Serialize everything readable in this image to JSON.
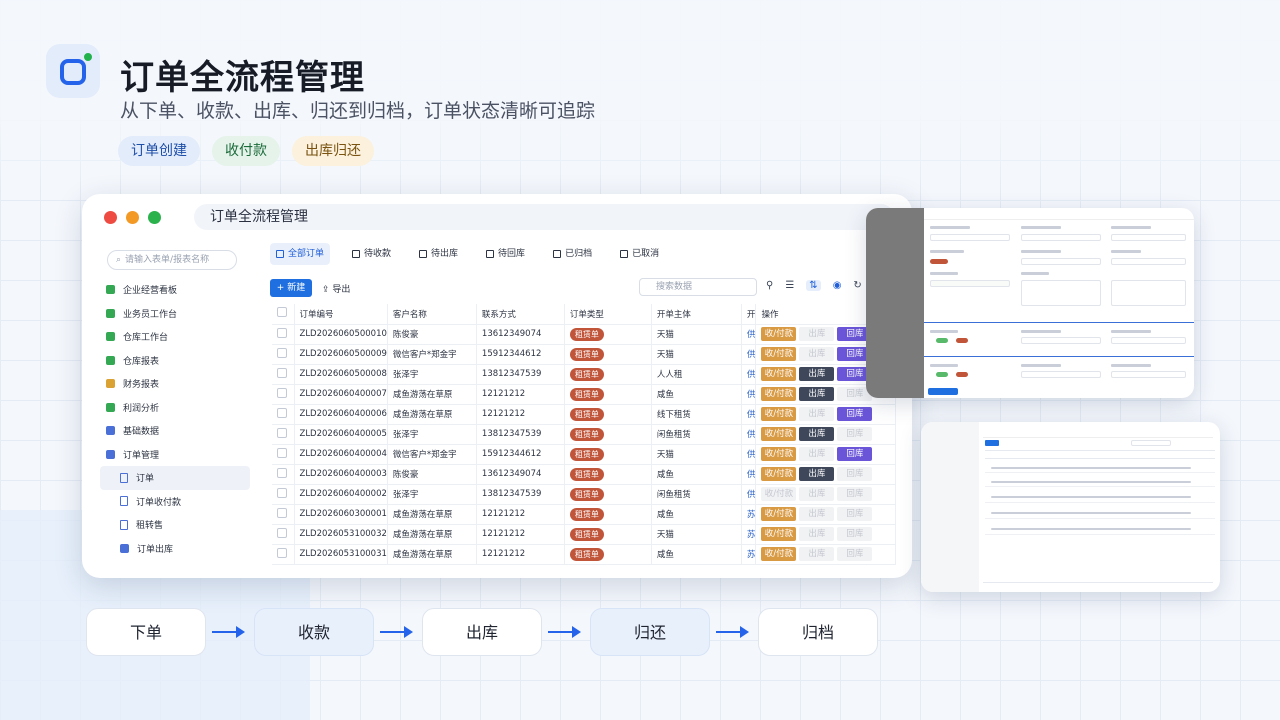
{
  "header": {
    "title": "订单全流程管理",
    "subtitle": "从下单、收款、出库、归还到归档，订单状态清晰可追踪",
    "tags": [
      "订单创建",
      "收付款",
      "出库归还"
    ]
  },
  "window": {
    "address_title": "订单全流程管理",
    "search_placeholder": "请输入表单/报表名称",
    "nav": [
      {
        "label": "企业经营看板",
        "icon": "dashboard-icon"
      },
      {
        "label": "业务员工作台",
        "icon": "user-icon"
      },
      {
        "label": "仓库工作台",
        "icon": "warehouse-icon"
      },
      {
        "label": "仓库报表",
        "icon": "bar-chart-icon"
      },
      {
        "label": "财务报表",
        "icon": "money-bag-icon"
      },
      {
        "label": "利润分析",
        "icon": "profit-icon"
      },
      {
        "label": "基础数据",
        "icon": "folder-icon"
      },
      {
        "label": "订单管理",
        "icon": "folder-icon"
      },
      {
        "label": "订单",
        "icon": "document-icon"
      },
      {
        "label": "订单收付款",
        "icon": "document-icon"
      },
      {
        "label": "租转售",
        "icon": "document-icon"
      },
      {
        "label": "订单出库",
        "icon": "truck-icon"
      }
    ],
    "tabs": [
      "全部订单",
      "待收款",
      "待出库",
      "待回库",
      "已归档",
      "已取消"
    ],
    "toolbar": {
      "new": "+ 新建",
      "export": "导出",
      "search_placeholder": "搜索数据"
    },
    "columns": [
      "订单编号",
      "客户名称",
      "联系方式",
      "订单类型",
      "开单主体",
      "开",
      "操作"
    ],
    "actions": {
      "pay": "收/付款",
      "out": "出库",
      "ret": "回库"
    },
    "rows": [
      {
        "id": "ZLD2026060500010",
        "customer": "陈俊豪",
        "phone": "13612349074",
        "type": "租赁单",
        "entity": "天猫",
        "cut": "供",
        "pay": true,
        "out": false,
        "ret": true
      },
      {
        "id": "ZLD2026060500009",
        "customer": "微信客户*郑金宇",
        "phone": "15912344612",
        "type": "租赁单",
        "entity": "天猫",
        "cut": "供",
        "pay": true,
        "out": false,
        "ret": true
      },
      {
        "id": "ZLD2026060500008",
        "customer": "张泽宇",
        "phone": "13812347539",
        "type": "租赁单",
        "entity": "人人租",
        "cut": "供",
        "pay": true,
        "out": true,
        "ret": true
      },
      {
        "id": "ZLD2026060400007",
        "customer": "咸鱼游荡在草原",
        "phone": "12121212",
        "type": "租赁单",
        "entity": "咸鱼",
        "cut": "供",
        "pay": true,
        "out": true,
        "ret": false
      },
      {
        "id": "ZLD2026060400006",
        "customer": "咸鱼游荡在草原",
        "phone": "12121212",
        "type": "租赁单",
        "entity": "线下租赁",
        "cut": "供",
        "pay": true,
        "out": false,
        "ret": true
      },
      {
        "id": "ZLD2026060400005",
        "customer": "张泽宇",
        "phone": "13812347539",
        "type": "租赁单",
        "entity": "闲鱼租赁",
        "cut": "供",
        "pay": true,
        "out": true,
        "ret": false
      },
      {
        "id": "ZLD2026060400004",
        "customer": "微信客户*郑金宇",
        "phone": "15912344612",
        "type": "租赁单",
        "entity": "天猫",
        "cut": "供",
        "pay": true,
        "out": false,
        "ret": true
      },
      {
        "id": "ZLD2026060400003",
        "customer": "陈俊豪",
        "phone": "13612349074",
        "type": "租赁单",
        "entity": "咸鱼",
        "cut": "供",
        "pay": true,
        "out": true,
        "ret": false
      },
      {
        "id": "ZLD2026060400002",
        "customer": "张泽宇",
        "phone": "13812347539",
        "type": "租赁单",
        "entity": "闲鱼租赁",
        "cut": "供",
        "pay": false,
        "out": false,
        "ret": false
      },
      {
        "id": "ZLD2026060300001",
        "customer": "咸鱼游荡在草原",
        "phone": "12121212",
        "type": "租赁单",
        "entity": "咸鱼",
        "cut": "苏",
        "pay": true,
        "out": false,
        "ret": false
      },
      {
        "id": "ZLD2026053100032",
        "customer": "咸鱼游荡在草原",
        "phone": "12121212",
        "type": "租赁单",
        "entity": "天猫",
        "cut": "苏",
        "pay": true,
        "out": false,
        "ret": false
      },
      {
        "id": "ZLD2026053100031",
        "customer": "咸鱼游荡在草原",
        "phone": "12121212",
        "type": "租赁单",
        "entity": "咸鱼",
        "cut": "苏",
        "pay": true,
        "out": false,
        "ret": false
      }
    ]
  },
  "flow": [
    "下单",
    "收款",
    "出库",
    "归还",
    "归档"
  ],
  "colors": {
    "accent": "#2563eb",
    "pay": "#d99a44",
    "out": "#3f475a",
    "ret": "#6a55d8",
    "pill": "#c0553a"
  }
}
